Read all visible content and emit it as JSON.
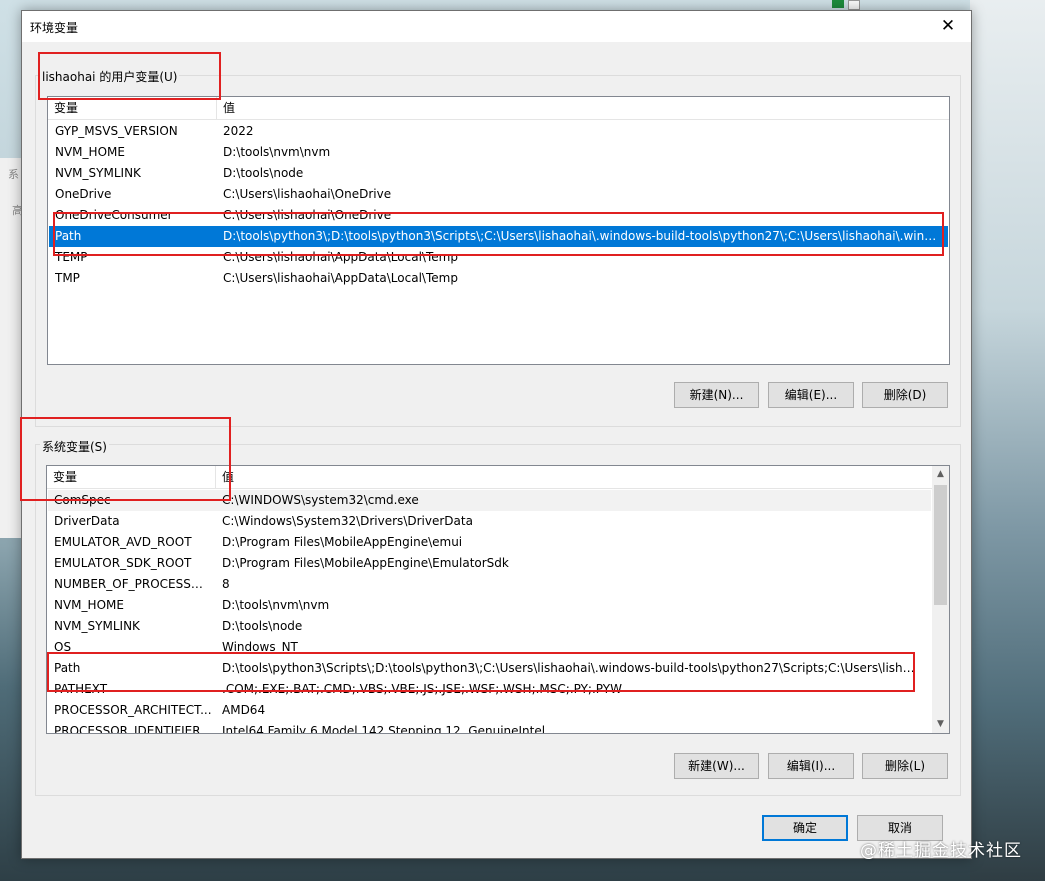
{
  "window": {
    "title": "环境变量",
    "close_glyph": "✕"
  },
  "user_vars": {
    "group_label": "lishaohai 的用户变量(U)",
    "headers": {
      "variable": "变量",
      "value": "值"
    },
    "rows": [
      {
        "name": "GYP_MSVS_VERSION",
        "value": "2022"
      },
      {
        "name": "NVM_HOME",
        "value": "D:\\tools\\nvm\\nvm"
      },
      {
        "name": "NVM_SYMLINK",
        "value": "D:\\tools\\node"
      },
      {
        "name": "OneDrive",
        "value": "C:\\Users\\lishaohai\\OneDrive"
      },
      {
        "name": "OneDriveConsumer",
        "value": "C:\\Users\\lishaohai\\OneDrive"
      },
      {
        "name": "Path",
        "value": "D:\\tools\\python3\\;D:\\tools\\python3\\Scripts\\;C:\\Users\\lishaohai\\.windows-build-tools\\python27\\;C:\\Users\\lishaohai\\.windo..."
      },
      {
        "name": "TEMP",
        "value": "C:\\Users\\lishaohai\\AppData\\Local\\Temp"
      },
      {
        "name": "TMP",
        "value": "C:\\Users\\lishaohai\\AppData\\Local\\Temp"
      }
    ],
    "selected_row": "Path",
    "buttons": {
      "new": "新建(N)...",
      "edit": "编辑(E)...",
      "delete": "删除(D)"
    }
  },
  "system_vars": {
    "group_label": "系统变量(S)",
    "headers": {
      "variable": "变量",
      "value": "值"
    },
    "rows": [
      {
        "name": "ComSpec",
        "value": "C:\\WINDOWS\\system32\\cmd.exe"
      },
      {
        "name": "DriverData",
        "value": "C:\\Windows\\System32\\Drivers\\DriverData"
      },
      {
        "name": "EMULATOR_AVD_ROOT",
        "value": "D:\\Program Files\\MobileAppEngine\\emui"
      },
      {
        "name": "EMULATOR_SDK_ROOT",
        "value": "D:\\Program Files\\MobileAppEngine\\EmulatorSdk"
      },
      {
        "name": "NUMBER_OF_PROCESSORS",
        "value": "8"
      },
      {
        "name": "NVM_HOME",
        "value": "D:\\tools\\nvm\\nvm"
      },
      {
        "name": "NVM_SYMLINK",
        "value": "D:\\tools\\node"
      },
      {
        "name": "OS",
        "value": "Windows_NT"
      },
      {
        "name": "Path",
        "value": "D:\\tools\\python3\\Scripts\\;D:\\tools\\python3\\;C:\\Users\\lishaohai\\.windows-build-tools\\python27\\Scripts;C:\\Users\\lishaoh..."
      },
      {
        "name": "PATHEXT",
        "value": ".COM;.EXE;.BAT;.CMD;.VBS;.VBE;.JS;.JSE;.WSF;.WSH;.MSC;.PY;.PYW"
      },
      {
        "name": "PROCESSOR_ARCHITECT...",
        "value": "AMD64"
      },
      {
        "name": "PROCESSOR_IDENTIFIER",
        "value": "Intel64 Family 6 Model 142 Stepping 12, GenuineIntel"
      }
    ],
    "buttons": {
      "new": "新建(W)...",
      "edit": "编辑(I)...",
      "delete": "删除(L)"
    }
  },
  "footer": {
    "ok": "确定",
    "cancel": "取消"
  },
  "watermark": "@稀土掘金技术社区",
  "colors": {
    "selection": "#0078d7",
    "annotation_box": "#e02020"
  }
}
